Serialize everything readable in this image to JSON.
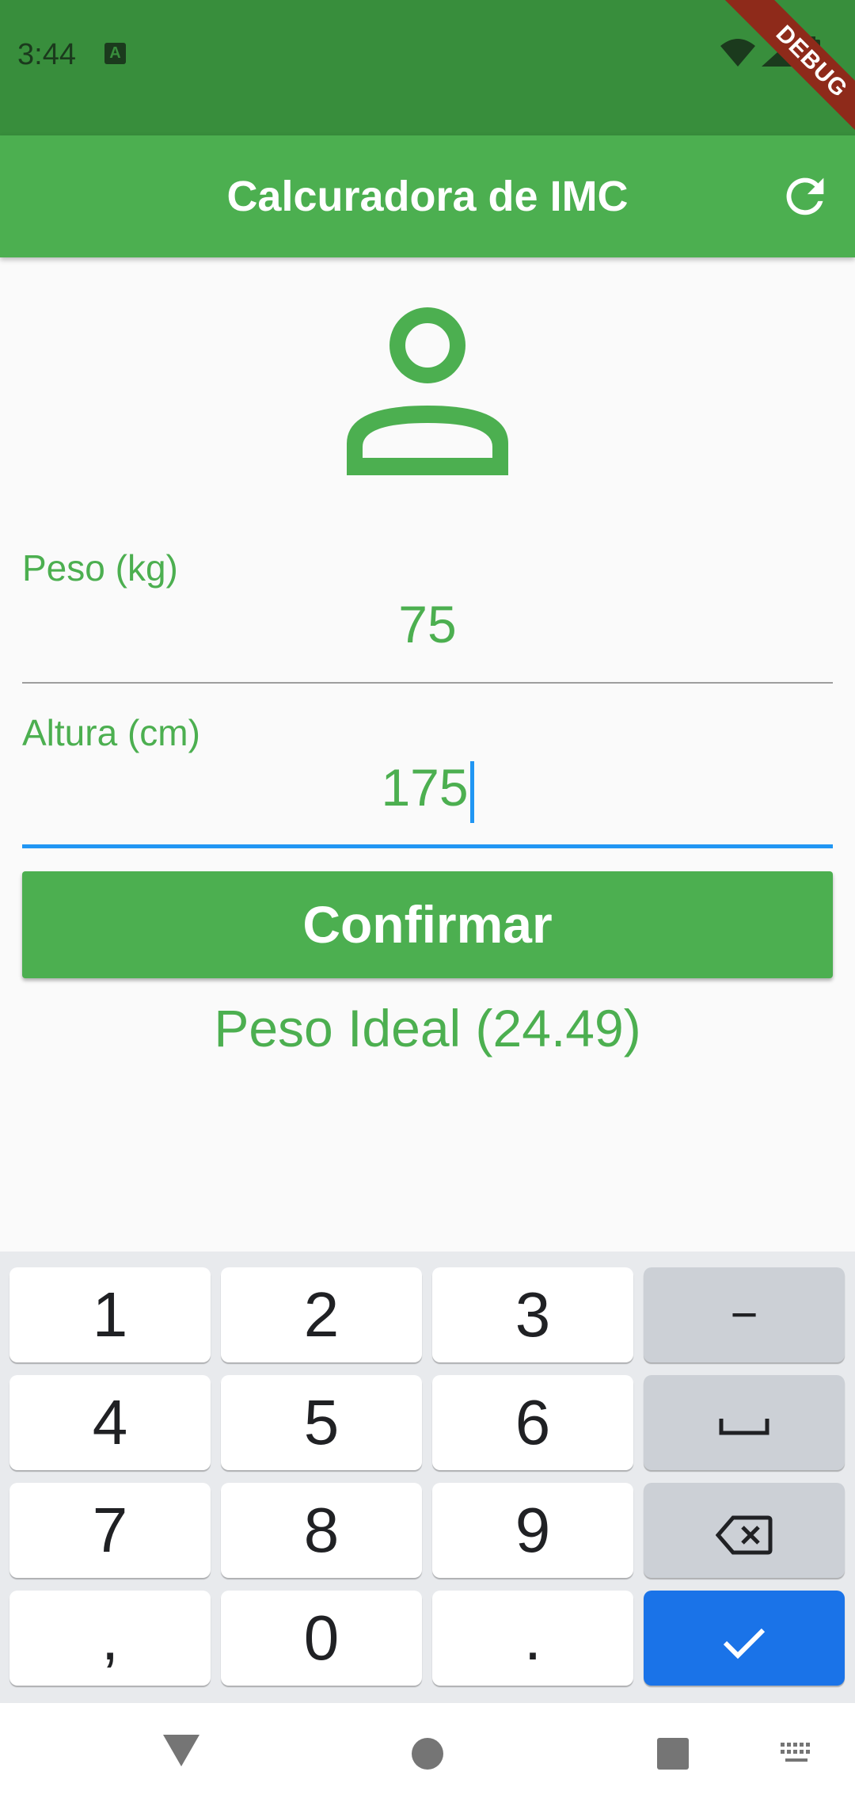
{
  "status_bar": {
    "time": "3:44",
    "notification_glyph": "A",
    "debug_banner": "DEBUG",
    "icons": [
      "wifi-icon",
      "signal-icon",
      "battery-icon"
    ]
  },
  "app_bar": {
    "title": "Calcuradora de IMC",
    "refresh_icon": "refresh-icon"
  },
  "avatar_icon": "person-outline-icon",
  "form": {
    "weight": {
      "label": "Peso (kg)",
      "value": "75"
    },
    "height": {
      "label": "Altura (cm)",
      "value": "175"
    }
  },
  "confirm_label": "Confirmar",
  "result": "Peso Ideal (24.49)",
  "keyboard": {
    "rows": [
      [
        "1",
        "2",
        "3",
        "−"
      ],
      [
        "4",
        "5",
        "6",
        "space"
      ],
      [
        "7",
        "8",
        "9",
        "backspace"
      ],
      [
        ",",
        "0",
        ".",
        "done"
      ]
    ]
  },
  "nav_bar": [
    "back-icon",
    "home-icon",
    "recents-icon",
    "keyboard-switch-icon"
  ],
  "colors": {
    "primary": "#4caf50",
    "primary_dark": "#388e3c",
    "focus": "#2196f3",
    "keyboard_action": "#1a73e8"
  }
}
